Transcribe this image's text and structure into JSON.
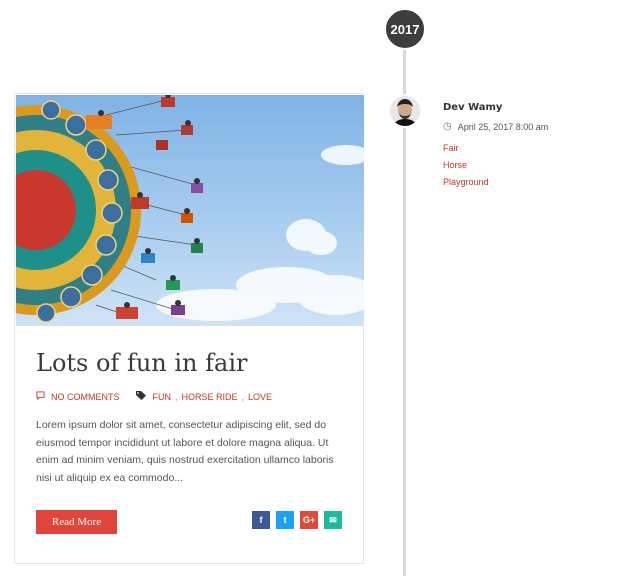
{
  "timeline": {
    "year": "2017"
  },
  "post": {
    "title": "Lots of fun in fair",
    "comments_label": "NO COMMENTS",
    "tags": [
      "FUN",
      "HORSE RIDE",
      "LOVE"
    ],
    "excerpt": "Lorem ipsum dolor sit amet, consectetur adipiscing elit, sed do eiusmod tempor incididunt ut labore et dolore magna aliqua. Ut enim ad minim veniam, quis nostrud exercitation ullamco laboris nisi ut aliquip ex ea commodo...",
    "read_more_label": "Read More",
    "image_alt": "fair swing ride"
  },
  "share": [
    {
      "network": "facebook",
      "glyph": "f",
      "color": "#3b5998"
    },
    {
      "network": "twitter",
      "glyph": "t",
      "color": "#1da1f2"
    },
    {
      "network": "google-plus",
      "glyph": "G+",
      "color": "#dd4b39"
    },
    {
      "network": "email",
      "glyph": "✉",
      "color": "#1abc9c"
    }
  ],
  "author": {
    "name": "Dev Wamy",
    "date": "April 25, 2017 8:00 am"
  },
  "sidebar_tags": [
    "Fair",
    "Horse",
    "Playground"
  ],
  "colors": {
    "accent": "#e0443a",
    "link": "#c0392b",
    "badge": "#3d3d3d",
    "timeline": "#d9d9d9"
  },
  "icons": {
    "comment": "comment-icon",
    "tag": "tag-icon",
    "clock": "clock-icon"
  }
}
